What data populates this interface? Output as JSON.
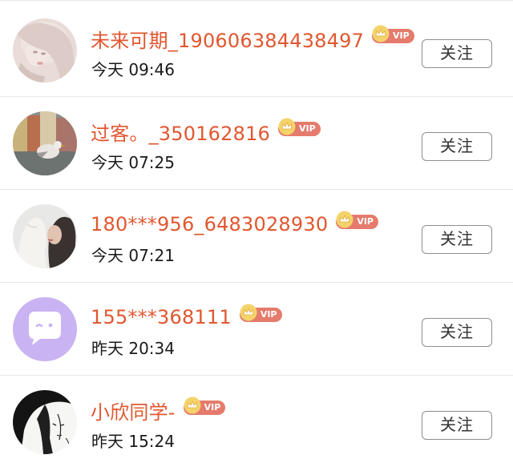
{
  "users": [
    {
      "name": "未来可期_190606384438497",
      "time": "今天 09:46",
      "vip_label": "VIP",
      "follow_label": "关注",
      "avatar": "portrait-light-hair"
    },
    {
      "name": "过客。_350162816",
      "time": "今天 07:25",
      "vip_label": "VIP",
      "follow_label": "关注",
      "avatar": "seagull-harbor"
    },
    {
      "name": "180***956_6483028930",
      "time": "今天 07:21",
      "vip_label": "VIP",
      "follow_label": "关注",
      "avatar": "statue-kiss"
    },
    {
      "name": "155***368111",
      "time": "昨天 20:34",
      "vip_label": "VIP",
      "follow_label": "关注",
      "avatar": "default-chat-bubble"
    },
    {
      "name": "小欣同学-",
      "time": "昨天 15:24",
      "vip_label": "VIP",
      "follow_label": "关注",
      "avatar": "manga-sketch"
    }
  ],
  "colors": {
    "name": "#e0572f",
    "vip_badge": "#e57b6c",
    "crown": "#f2c14e",
    "default_avatar_bg": "#c9b3f2"
  }
}
